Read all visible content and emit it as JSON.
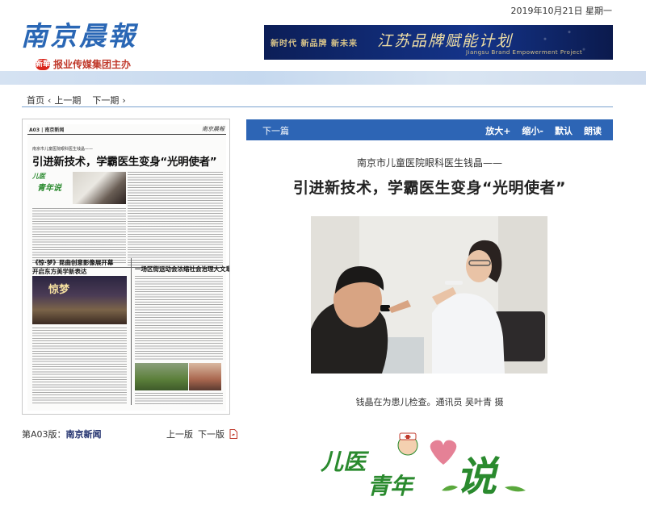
{
  "header": {
    "masthead": "南京晨報",
    "publisher_logo": "新華",
    "publisher": "报业传媒集团主办",
    "date": "2019年10月21日  星期一",
    "banner": {
      "slogan": "新时代  新品牌  新未来",
      "title": "江苏品牌赋能计划",
      "subtitle": "Jiangsu Brand Empowerment Project"
    }
  },
  "nav": {
    "home": "首页",
    "prev_issue": "上一期",
    "next_issue": "下一期"
  },
  "page_thumb": {
    "page_no": "A03",
    "section": "南京新闻",
    "brand": "南京晨報",
    "story1_kicker": "南京市儿童医院眼科医生钱晶——",
    "story1_title": "引进新技术，学霸医生变身“光明使者”",
    "logo_line1": "儿医",
    "logo_line2": "青年说",
    "story2_title_line1": "《惊·梦》昆曲创意影像展开幕",
    "story2_title_line2": "开启东方美学新表达",
    "story2_photo_text": "惊梦",
    "story3_title": "一场区街运动会浓缩社会治理大文章"
  },
  "page_footer": {
    "prefix": "第A03版：",
    "section": "南京新闻",
    "prev_page": "上一版",
    "next_page": "下一版"
  },
  "article_toolbar": {
    "next_article": "下一篇",
    "zoom_in": "放大+",
    "zoom_out": "缩小-",
    "default": "默认",
    "read_aloud": "朗读"
  },
  "article": {
    "kicker": "南京市儿童医院眼科医生钱晶——",
    "title": "引进新技术，学霸医生变身“光明使者”",
    "caption": "钱晶在为患儿检查。通讯员  吴叶青  摄"
  },
  "column_logo": {
    "line1": "儿医",
    "line2": "青年",
    "line3": "说"
  },
  "colors": {
    "brand_blue": "#2a67b5",
    "toolbar_blue": "#2d65b5",
    "logo_green": "#2a8a2e"
  }
}
